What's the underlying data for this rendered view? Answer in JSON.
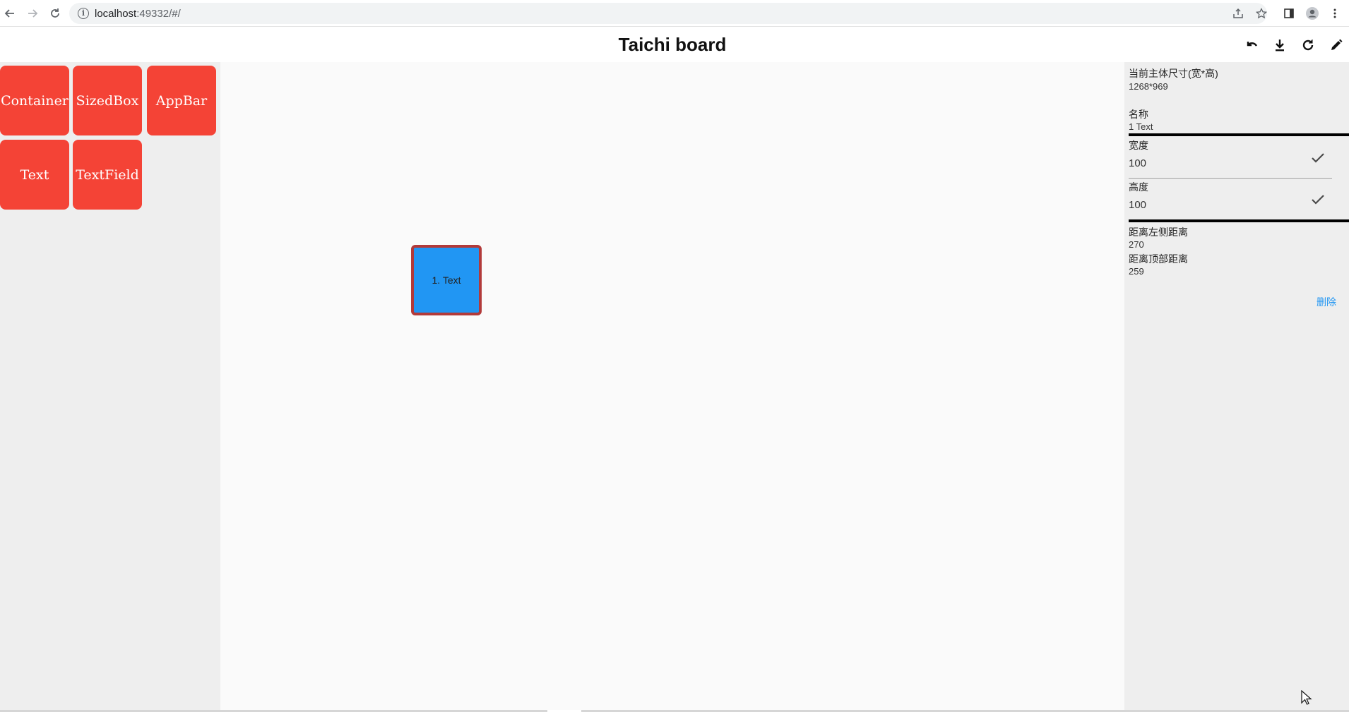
{
  "browser": {
    "url_host": "localhost",
    "url_rest": ":49332/#/",
    "back_icon": "arrow-left-icon",
    "forward_icon": "arrow-right-icon",
    "reload_icon": "reload-icon",
    "info_glyph": "i"
  },
  "header": {
    "title": "Taichi board",
    "actions": [
      "undo-icon",
      "download-icon",
      "refresh-icon",
      "edit-icon"
    ]
  },
  "palette": {
    "items": [
      {
        "label": "Container"
      },
      {
        "label": "SizedBox"
      },
      {
        "label": "AppBar"
      },
      {
        "label": "Text"
      },
      {
        "label": "TextField"
      }
    ],
    "tile_color": "#f44336"
  },
  "canvas": {
    "widget": {
      "label": "1. Text",
      "fill": "#2196f3",
      "border": "#b23a3a"
    }
  },
  "props": {
    "size_label": "当前主体尺寸(宽*高)",
    "size_value": "1268*969",
    "name_label": "名称",
    "name_value": "1 Text",
    "width_label": "宽度",
    "width_value": "100",
    "height_label": "高度",
    "height_value": "100",
    "left_label": "距离左侧距离",
    "left_value": "270",
    "top_label": "距离顶部距离",
    "top_value": "259",
    "delete_label": "删除"
  },
  "colors": {
    "accent_blue": "#2196f3",
    "tile_red": "#f44336",
    "panel_bg": "#eeeeee",
    "canvas_bg": "#fafafa"
  }
}
